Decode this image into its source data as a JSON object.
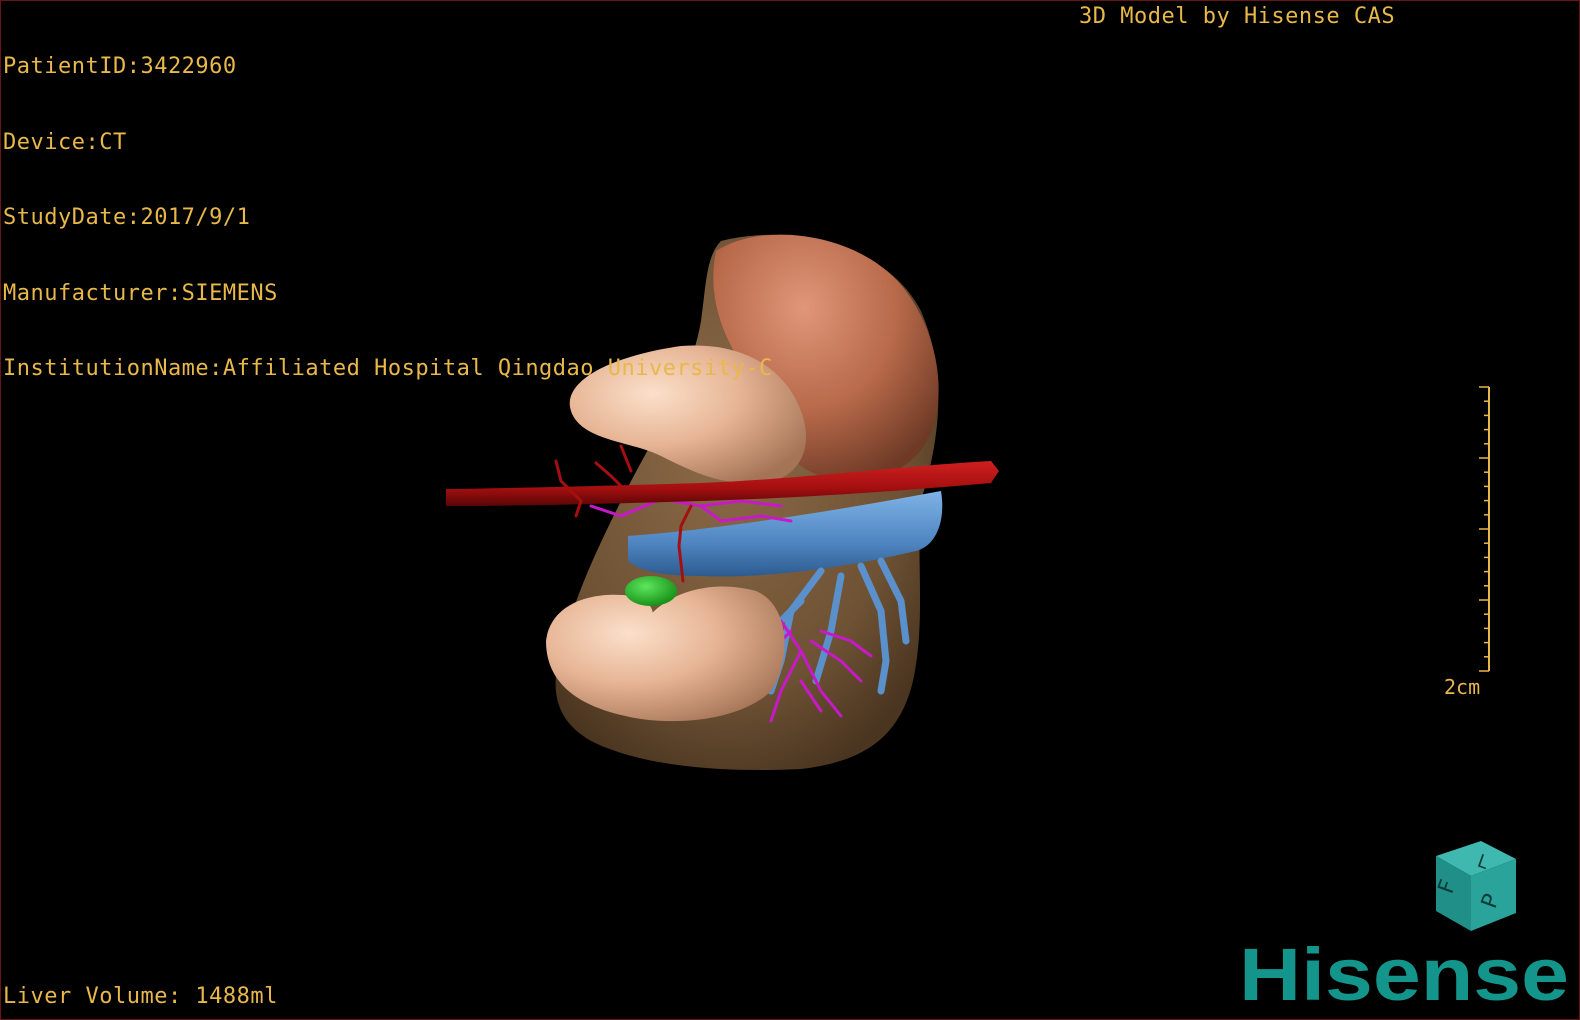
{
  "patient_info": {
    "patient_id": "PatientID:3422960",
    "device": "Device:CT",
    "study_date": "StudyDate:2017/9/1",
    "manufacturer": "Manufacturer:SIEMENS",
    "institution": "InstitutionName:Affiliated Hospital Qingdao University-C"
  },
  "model_credit": "3D Model by Hisense CAS",
  "liver_volume": "Liver Volume: 1488ml",
  "scale_bar": {
    "label": "2cm"
  },
  "orientation_cube": {
    "labels": [
      "F",
      "L",
      "P"
    ]
  },
  "brand": {
    "name": "Hisense",
    "color": "#14958c"
  },
  "colors": {
    "overlay_text": "#e8b84a",
    "liver": "#7a5a3a",
    "kidney": "#e3b08e",
    "spleen": "#b86a4a",
    "aorta": "#a50f0f",
    "portal_vein": "#5a90cc",
    "artery_branches": "#c819c8",
    "gallbladder": "#1fa61f"
  },
  "organs": [
    "liver",
    "kidney-upper",
    "spleen",
    "kidney-lower",
    "aorta",
    "portal-vein",
    "hepatic-arteries",
    "gallbladder"
  ]
}
